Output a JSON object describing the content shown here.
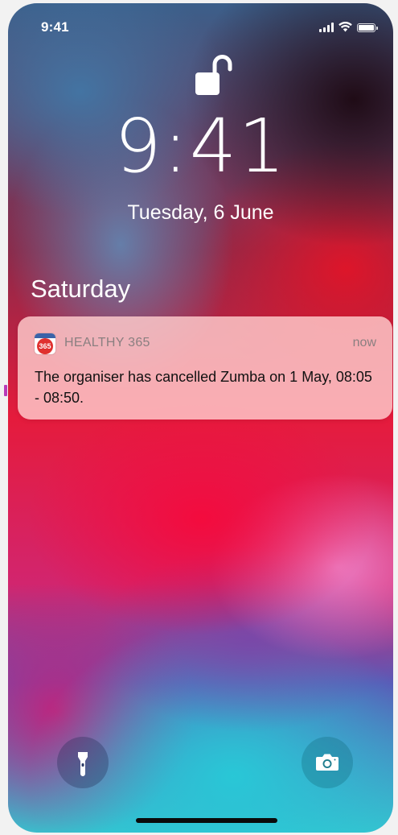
{
  "status_bar": {
    "time": "9:41",
    "signal_icon": "cellular-signal-icon",
    "wifi_icon": "wifi-icon",
    "battery_icon": "battery-icon",
    "battery_level": 1.0
  },
  "lock_screen": {
    "lock_icon": "unlocked-padlock-icon",
    "clock": "9:41",
    "date": "Tuesday, 6 June"
  },
  "notifications": {
    "section_title": "Saturday",
    "items": [
      {
        "app_icon": "calendar-365-icon",
        "app_icon_text": "365",
        "app_name": "HEALTHY 365",
        "time": "now",
        "message": "The organiser has cancelled Zumba on 1 May, 08:05 - 08:50."
      }
    ]
  },
  "quick_actions": {
    "flashlight_icon": "flashlight-icon",
    "camera_icon": "camera-icon"
  },
  "colors": {
    "notification_bg": "#ffcdcd",
    "secondary_text": "#8a7f80",
    "body_text": "#111111",
    "app_icon_red": "#e0312f",
    "app_icon_blue": "#3b63a8"
  }
}
